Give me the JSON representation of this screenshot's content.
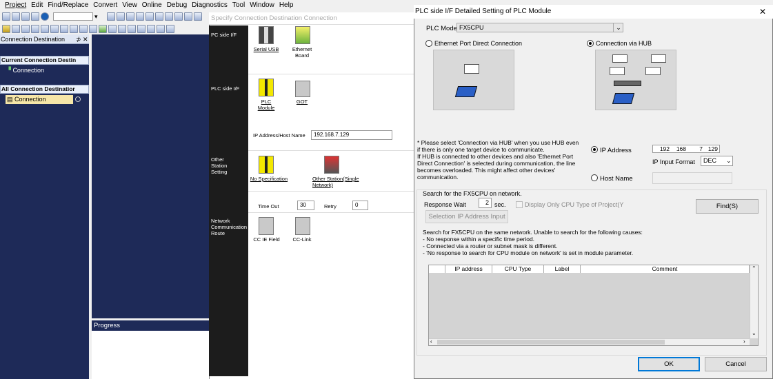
{
  "menu": [
    "Project",
    "Edit",
    "Find/Replace",
    "Convert",
    "View",
    "Online",
    "Debug",
    "Diagnostics",
    "Tool",
    "Window",
    "Help"
  ],
  "left_panel": {
    "title": "Connection Destination",
    "pin": "⊅",
    "close": "✕",
    "current_group": "Current Connection Destin",
    "current_item": "Connection",
    "all_group": "All Connection Destinatior",
    "all_item": "Connection"
  },
  "progress": {
    "title": "Progress"
  },
  "specify": {
    "title": "Specify Connection Destination Connection",
    "sections": {
      "pc_side": "PC side I/F",
      "plc_side": "PLC side I/F",
      "other_station": "Other Station Setting",
      "network_route": "Network Communication Route"
    },
    "pc_icons": {
      "serial": "Serial USB",
      "ethernet": "Ethernet Board"
    },
    "plc_icons": {
      "plc_module": "PLC Module",
      "got": "GOT"
    },
    "ip_label": "IP Address/Host Name",
    "ip_value": "192.168.7.129",
    "other_icons": {
      "no_spec": "No Specification",
      "other_single": "Other Station(Single Network)"
    },
    "timeout_label": "Time Out",
    "timeout_value": "30",
    "retry_label": "Retry",
    "retry_value": "0",
    "route_icons": {
      "cc_ie": "CC IE Field",
      "cc_link": "CC-Link"
    }
  },
  "detail": {
    "title": "PLC side I/F Detailed Setting of PLC Module",
    "close": "✕",
    "plc_mode_label": "PLC Mode",
    "plc_mode_value": "FX5CPU",
    "direct_label": "Ethernet Port Direct Connection",
    "hub_label": "Connection via HUB",
    "note": "* Please select 'Connection via HUB' when you use HUB even if there is only one target device to communicate.\nIf HUB is connected to other devices and also 'Ethernet Port Direct Connection' is selected during communication, the line becomes overloaded. This might affect other devices' communication.",
    "ip_address_label": "IP Address",
    "ip_octets": [
      "192",
      "168",
      "7",
      "129"
    ],
    "ip_format_label": "IP Input Format",
    "ip_format_value": "DEC",
    "host_name_label": "Host Name",
    "search_title": "Search for the FX5CPU on network.",
    "response_wait_label": "Response Wait",
    "response_wait_value": "2",
    "response_wait_unit": "sec.",
    "display_only_label": "Display Only CPU Type of Project(Y",
    "find_button": "Find(S)",
    "selection_ip_button": "Selection IP Address Input",
    "search_info": "Search for FX5CPU on the same network. Unable to search for the following causes:\n- No response within a specific time period.\n- Connected via a router or subnet mask is different.\n- 'No response to search for CPU module on network' is set in module parameter.",
    "columns": [
      "IP address",
      "CPU Type",
      "Label",
      "Comment"
    ],
    "ok_button": "OK",
    "cancel_button": "Cancel"
  }
}
